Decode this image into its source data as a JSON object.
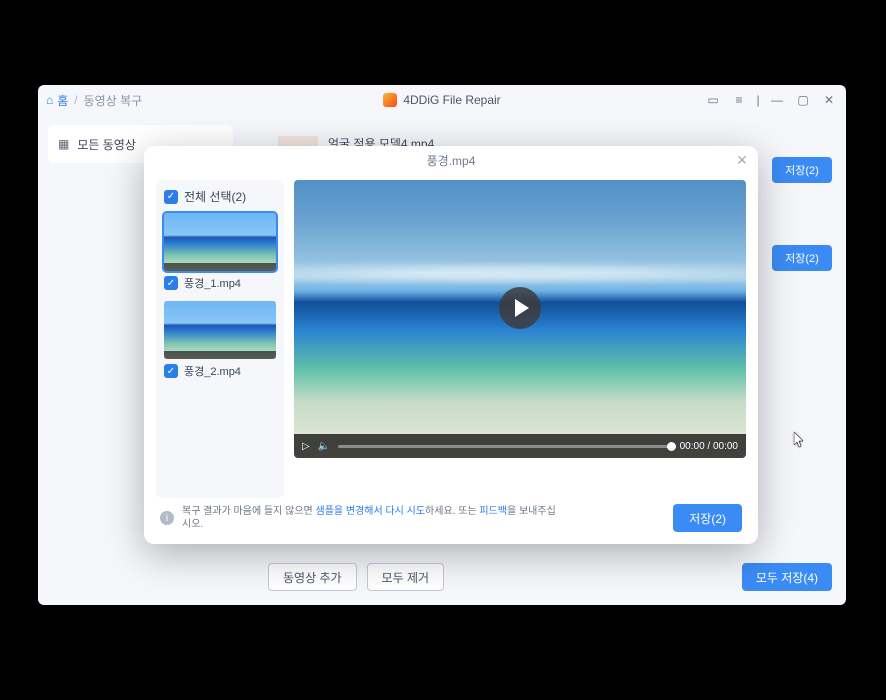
{
  "titlebar": {
    "home": "홈",
    "separator": "/",
    "current": "동영상 복구",
    "app_title": "4DDiG File Repair"
  },
  "sidebar": {
    "all_videos": "모든 동영상"
  },
  "list_header": {
    "filename": "얼굴 적용 모델4.mp4"
  },
  "save_buttons": {
    "save2_top": "저장(2)",
    "save2_mid": "저장(2)"
  },
  "footer": {
    "add_video": "동영상 추가",
    "remove_all": "모두 제거",
    "save_all": "모두 저장(4)"
  },
  "modal": {
    "title": "풍경.mp4",
    "select_all": "전체 선택(2)",
    "thumbs": [
      {
        "label": "풍경_1.mp4"
      },
      {
        "label": "풍경_2.mp4"
      }
    ],
    "playback": {
      "time": "00:00 / 00:00"
    },
    "hint_pre": "복구 결과가 마음에 들지 않으면 ",
    "hint_link1": "샘플을 변경해서 다시 시도",
    "hint_mid": "하세요. 또는 ",
    "hint_link2": "피드백",
    "hint_post": "을 보내주십시오.",
    "save": "저장(2)"
  }
}
